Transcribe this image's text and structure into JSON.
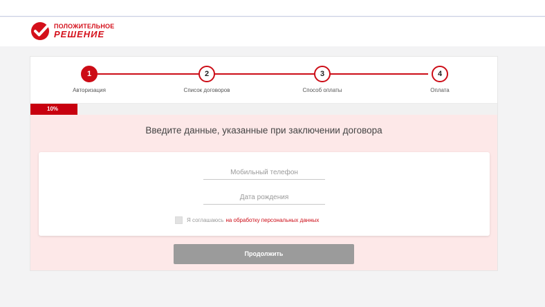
{
  "brand": {
    "line1": "ПОЛОЖИТЕЛЬНОЕ",
    "line2": "РЕШЕНИЕ",
    "color": "#d4101b",
    "icon": "checkmark-icon"
  },
  "steps": [
    {
      "number": "1",
      "label": "Авторизация",
      "active": true
    },
    {
      "number": "2",
      "label": "Список договоров",
      "active": false
    },
    {
      "number": "3",
      "label": "Способ оплаты",
      "active": false
    },
    {
      "number": "4",
      "label": "Оплата",
      "active": false
    }
  ],
  "progress": {
    "label": "10%",
    "value": 0.1
  },
  "form": {
    "headline": "Введите данные, указанные при заключении договора",
    "phone_placeholder": "Мобильный телефон",
    "birth_placeholder": "Дата рождения",
    "agree_text": "Я соглашаюсь",
    "agree_link": "на обработку персональных данных",
    "agree_checked": false
  },
  "actions": {
    "continue_label": "Продолжить"
  },
  "colors": {
    "accent": "#cc0c16",
    "form_background": "#fde8e8",
    "button_disabled": "#9b9b9b"
  }
}
